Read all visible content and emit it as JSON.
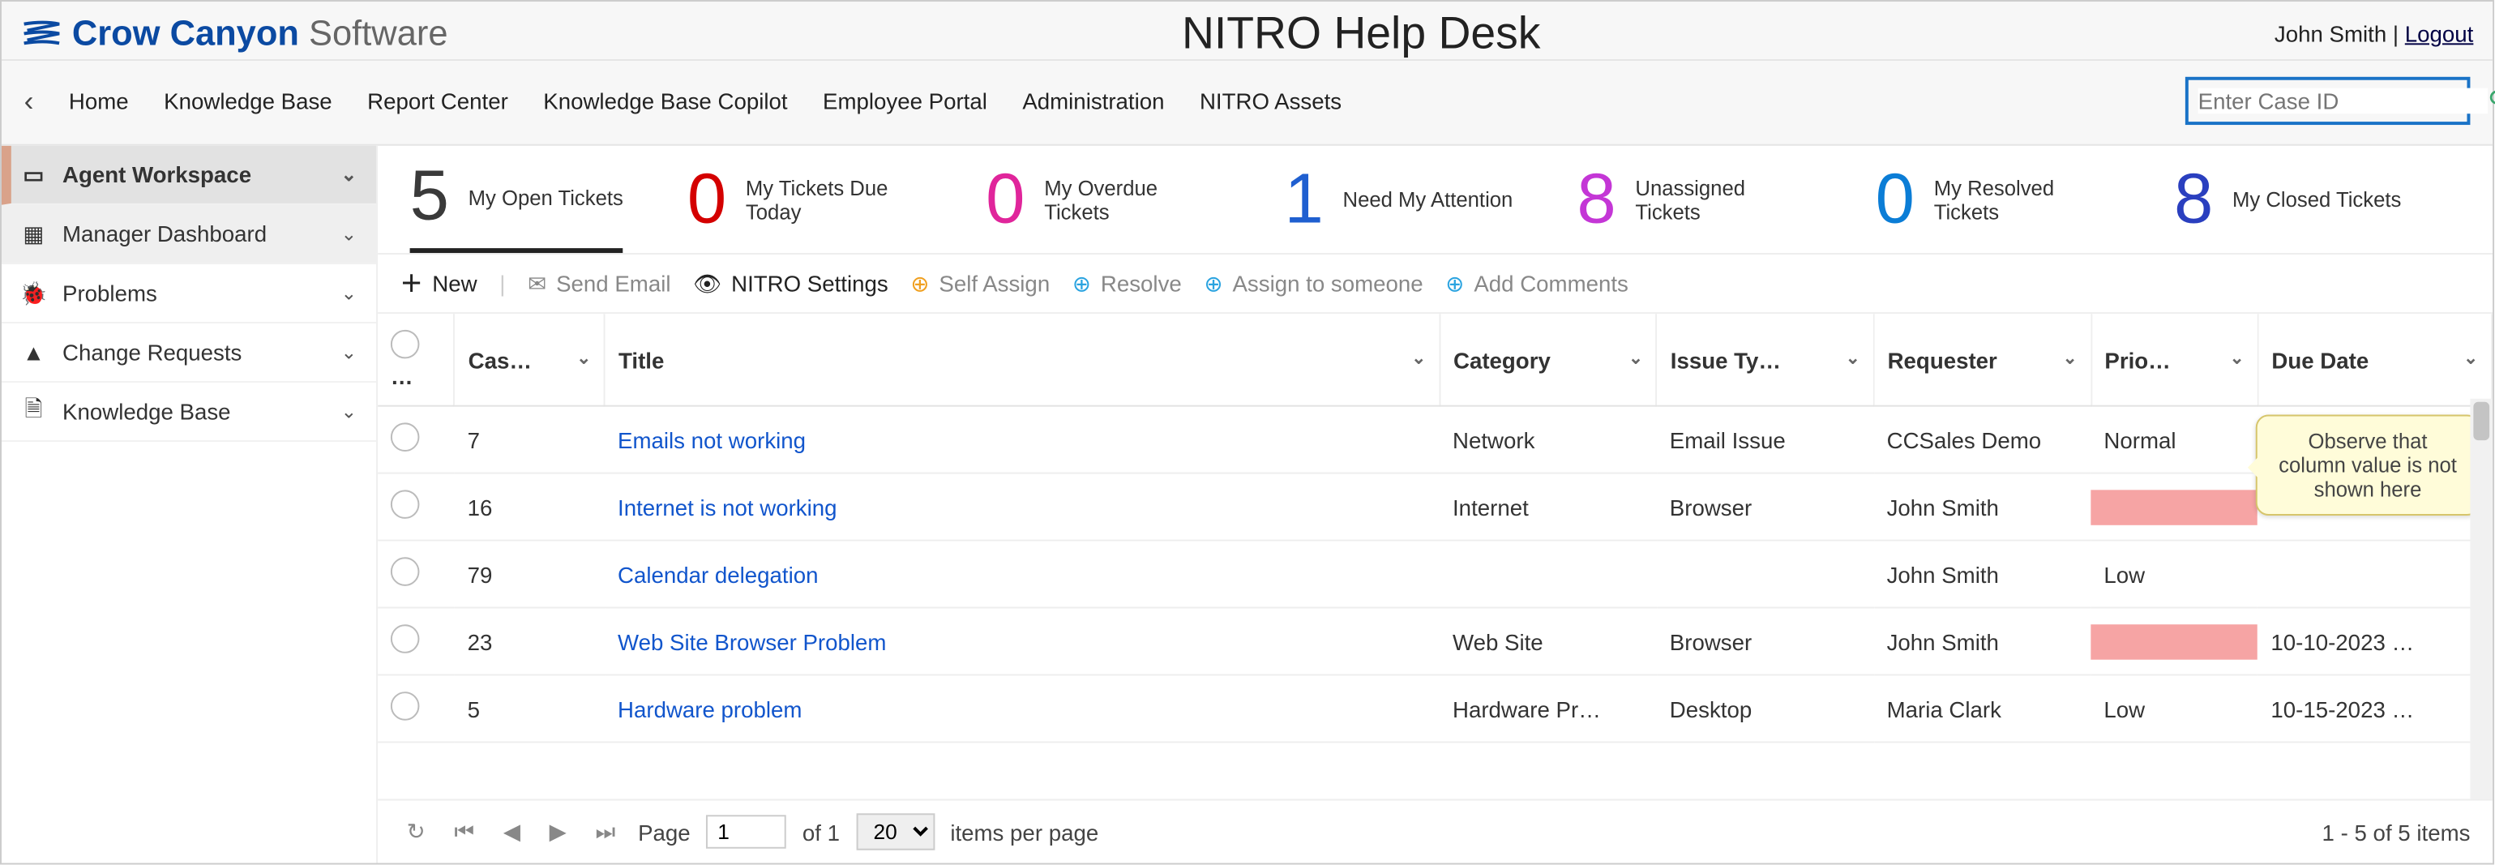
{
  "header": {
    "brand_main": "Crow Canyon",
    "brand_sub": "Software",
    "app_title": "NITRO Help Desk",
    "user": "John Smith",
    "logout": "Logout"
  },
  "nav": {
    "items": [
      "Home",
      "Knowledge Base",
      "Report Center",
      "Knowledge Base Copilot",
      "Employee Portal",
      "Administration",
      "NITRO Assets"
    ],
    "search_placeholder": "Enter Case ID"
  },
  "sidebar": {
    "items": [
      {
        "label": "Agent Workspace",
        "active": true
      },
      {
        "label": "Manager Dashboard",
        "sub": true
      },
      {
        "label": "Problems"
      },
      {
        "label": "Change Requests"
      },
      {
        "label": "Knowledge Base"
      }
    ]
  },
  "stats": [
    {
      "value": "5",
      "label": "My Open Tickets",
      "color": "#3a3a3a",
      "active": true
    },
    {
      "value": "0",
      "label": "My Tickets Due Today",
      "color": "#d40000"
    },
    {
      "value": "0",
      "label": "My Overdue Tickets",
      "color": "#e0259b"
    },
    {
      "value": "1",
      "label": "Need My Attention",
      "color": "#1f5fd0"
    },
    {
      "value": "8",
      "label": "Unassigned Tickets",
      "color": "#c436d6"
    },
    {
      "value": "0",
      "label": "My Resolved Tickets",
      "color": "#0b7dd6"
    },
    {
      "value": "8",
      "label": "My Closed Tickets",
      "color": "#2a3fbf"
    }
  ],
  "toolbar": {
    "new": "New",
    "send_email": "Send Email",
    "nitro_settings": "NITRO Settings",
    "self_assign": "Self Assign",
    "resolve": "Resolve",
    "assign": "Assign to someone",
    "add_comments": "Add Comments"
  },
  "columns": [
    "Cas…",
    "Title",
    "Category",
    "Issue Ty…",
    "Requester",
    "Prio…",
    "Due Date"
  ],
  "rows": [
    {
      "case": "7",
      "title": "Emails not working",
      "category": "Network",
      "issue": "Email Issue",
      "requester": "CCSales Demo",
      "priority": "Normal",
      "due": ""
    },
    {
      "case": "16",
      "title": "Internet is not working",
      "category": "Internet",
      "issue": "Browser",
      "requester": "John Smith",
      "priority": "__red__",
      "due": ""
    },
    {
      "case": "79",
      "title": "Calendar delegation",
      "category": "",
      "issue": "",
      "requester": "John Smith",
      "priority": "Low",
      "due": ""
    },
    {
      "case": "23",
      "title": "Web Site Browser Problem",
      "category": "Web Site",
      "issue": "Browser",
      "requester": "John Smith",
      "priority": "__red__",
      "due": "10-10-2023 …"
    },
    {
      "case": "5",
      "title": "Hardware problem",
      "category": "Hardware Pr…",
      "issue": "Desktop",
      "requester": "Maria Clark",
      "priority": "Low",
      "due": "10-15-2023 …"
    }
  ],
  "pager": {
    "page_label": "Page",
    "page_value": "1",
    "of_label": "of 1",
    "size": "20",
    "items_label": "items per page",
    "range": "1 - 5 of 5 items"
  },
  "callout": "Observe that column value is not shown here"
}
